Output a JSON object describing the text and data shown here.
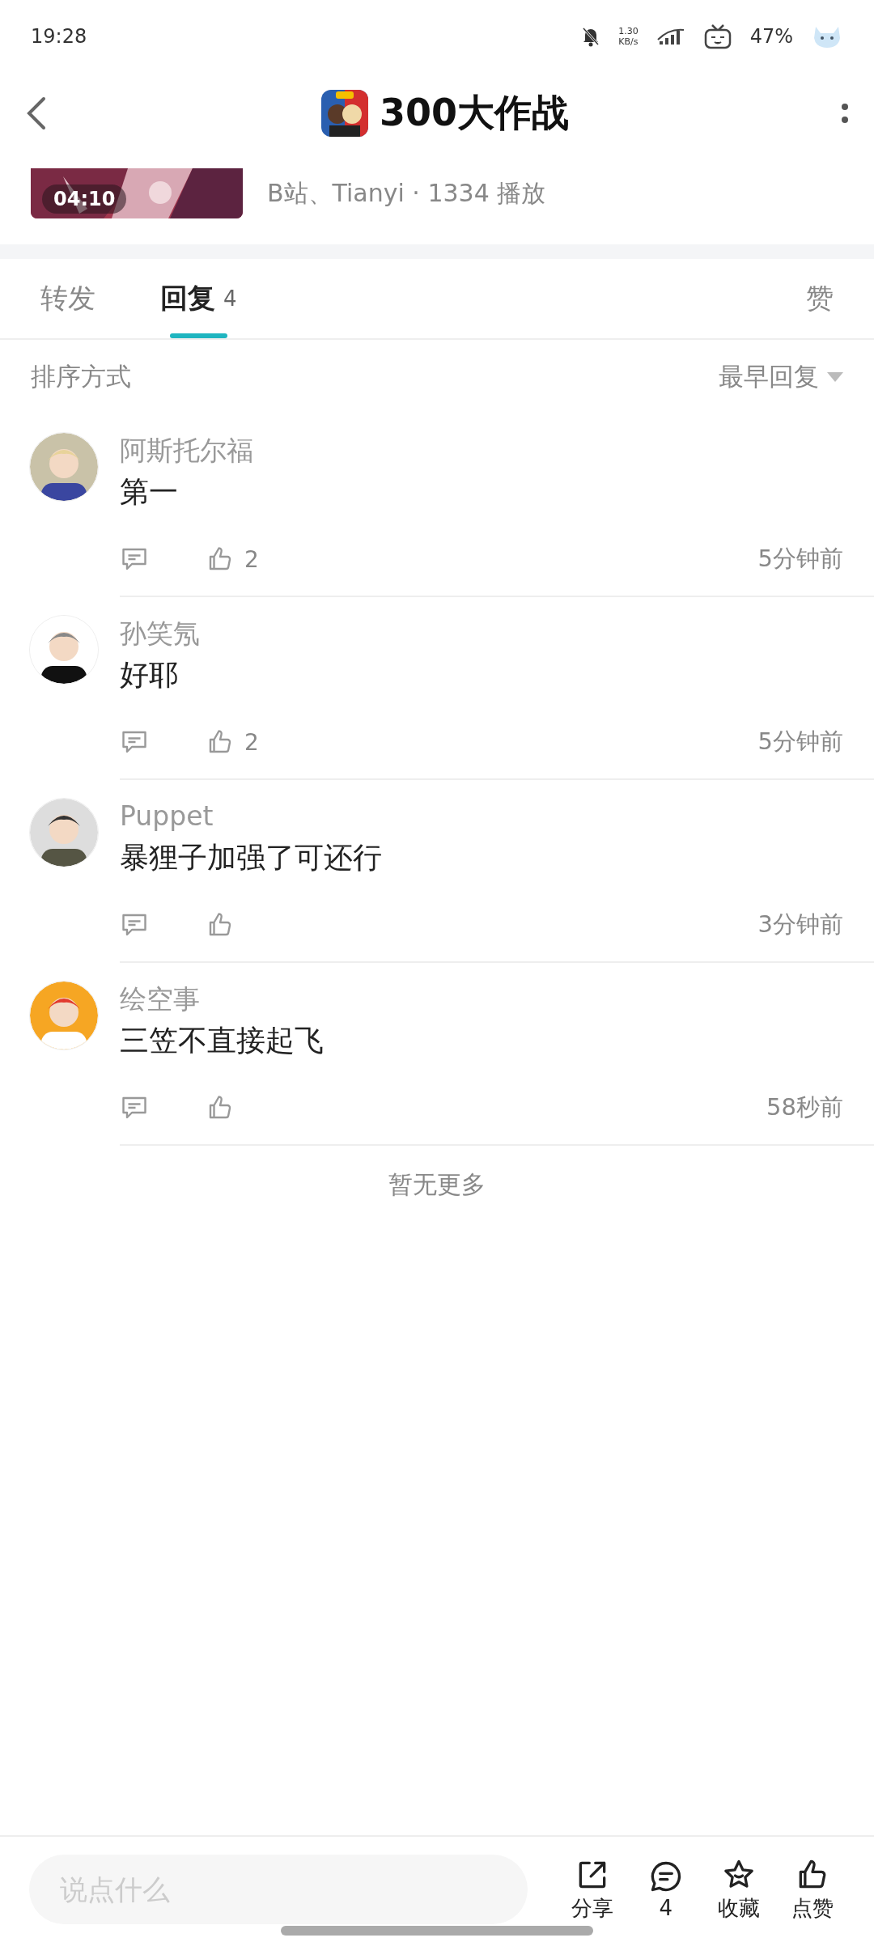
{
  "status_bar": {
    "time": "19:28",
    "speed": "1.30",
    "speed_unit": "KB/s",
    "battery": "47%"
  },
  "header": {
    "title": "300大作战"
  },
  "video": {
    "duration": "04:10",
    "meta": "B站、Tianyi · 1334 播放"
  },
  "tabs": [
    {
      "label": "转发",
      "selected": false
    },
    {
      "label": "回复",
      "count": "4",
      "selected": true
    },
    {
      "label": "赞",
      "selected": false
    }
  ],
  "sort": {
    "label": "排序方式",
    "value": "最早回复"
  },
  "comments": [
    {
      "name": "阿斯托尔福",
      "text": "第一",
      "likes": "2",
      "time": "5分钟前"
    },
    {
      "name": "孙笑氖",
      "text": "好耶",
      "likes": "2",
      "time": "5分钟前"
    },
    {
      "name": "Puppet",
      "text": "暴狸子加强了可还行",
      "time": "3分钟前"
    },
    {
      "name": "绘空事",
      "text": "三笠不直接起飞",
      "time": "58秒前"
    }
  ],
  "footer_note": "暂无更多",
  "bottom_bar": {
    "placeholder": "说点什么",
    "actions": [
      {
        "kind": "share",
        "label": "分享"
      },
      {
        "kind": "comment",
        "label": "4"
      },
      {
        "kind": "favorite",
        "label": "收藏"
      },
      {
        "kind": "like",
        "label": "点赞"
      }
    ]
  }
}
